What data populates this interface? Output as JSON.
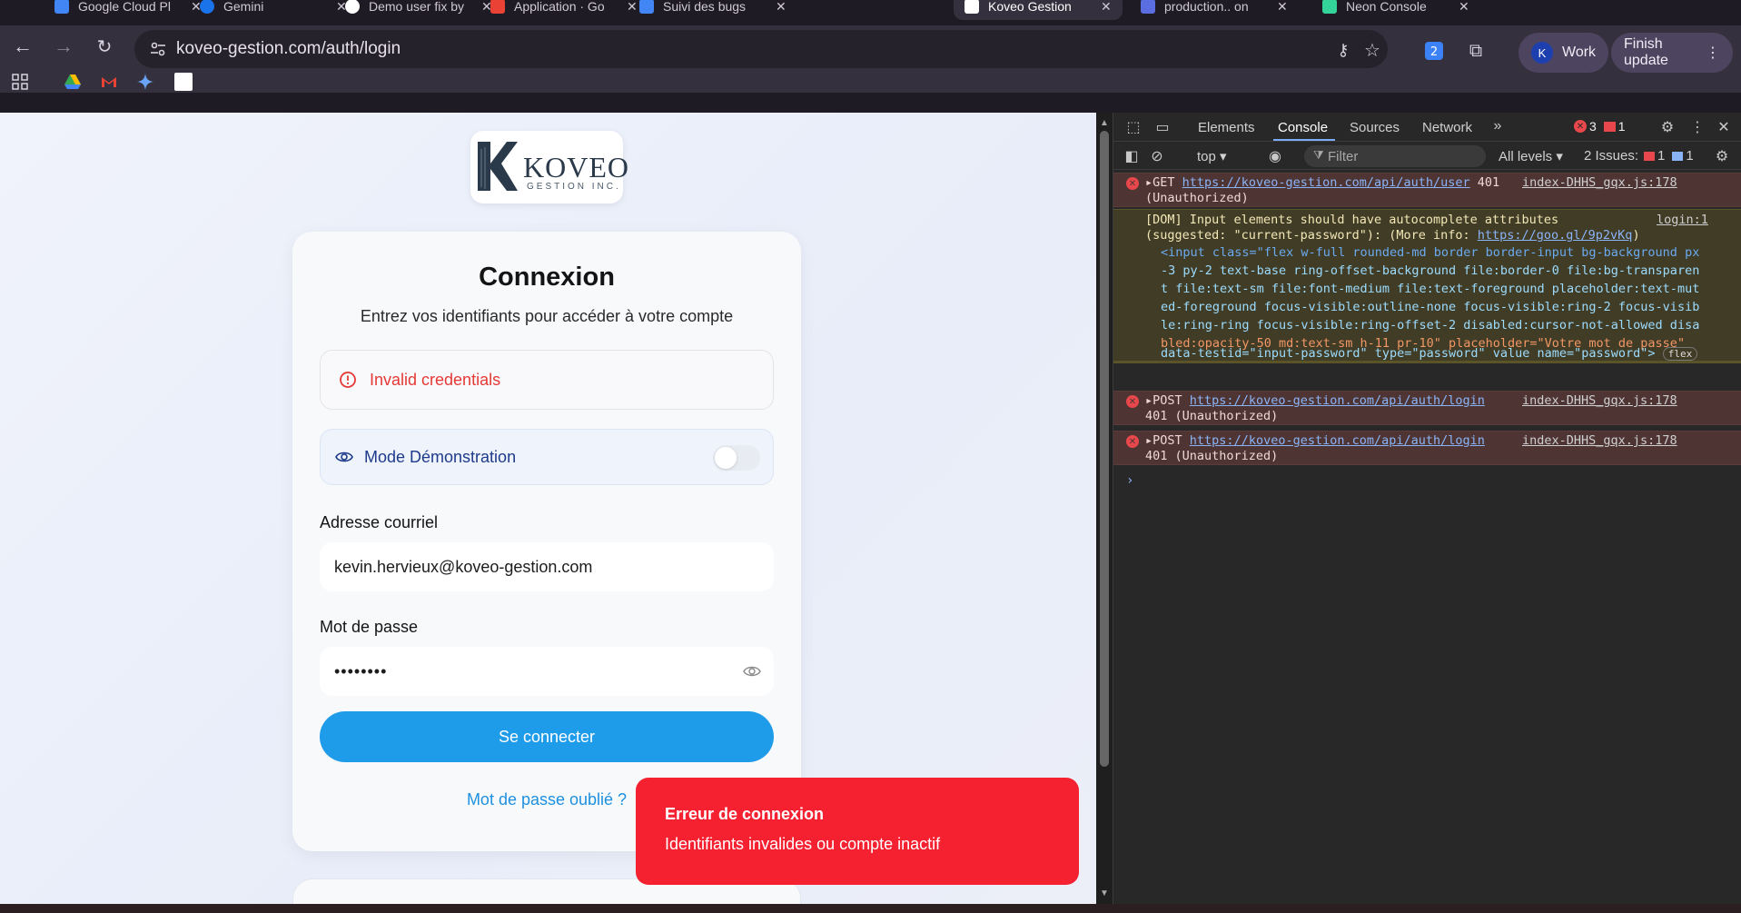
{
  "browser": {
    "tabs": [
      {
        "title": "Google Cloud Pl",
        "fav_color": "#4285f4"
      },
      {
        "title": "Gemini",
        "fav_color": "#1a73e8"
      },
      {
        "title": "Demo user fix by",
        "fav_color": "#ffffff"
      },
      {
        "title": "Application · Go",
        "fav_color": "#ea4335"
      },
      {
        "title": "Suivi des bugs",
        "fav_color": "#4285f4"
      },
      {
        "title": "Koveo Gestion",
        "fav_color": "#ffffff"
      },
      {
        "title": "production.. on",
        "fav_color": "#5b6ee1"
      },
      {
        "title": "Neon Console",
        "fav_color": "#34d399"
      }
    ],
    "url": "koveo-gestion.com/auth/login",
    "profile_label": "Work",
    "profile_initial": "K",
    "update_label": "Finish update",
    "extension_badge": "2"
  },
  "page": {
    "logo_text": "KOVEO",
    "logo_sub": "GESTION INC.",
    "title": "Connexion",
    "subtitle": "Entrez vos identifiants pour accéder à votre compte",
    "alert_text": "Invalid credentials",
    "demo_label": "Mode Démonstration",
    "email_label": "Adresse courriel",
    "email_value": "kevin.hervieux@koveo-gestion.com",
    "password_label": "Mot de passe",
    "password_value": "••••••••",
    "submit_label": "Se connecter",
    "forgot_label": "Mot de passe oublié ?",
    "toast_title": "Erreur de connexion",
    "toast_message": "Identifiants invalides ou compte inactif"
  },
  "devtools": {
    "tabs": [
      "Elements",
      "Console",
      "Sources",
      "Network"
    ],
    "active_tab": "Console",
    "error_count": "3",
    "warn_count": "1",
    "context": "top",
    "filter_placeholder": "Filter",
    "levels": "All levels",
    "issues_label": "2 Issues:",
    "issues_err": "1",
    "issues_info": "1",
    "messages": {
      "m1_method": "GET",
      "m1_url": "https://koveo-gestion.com/api/auth/user",
      "m1_status": "401",
      "m1_status2": "(Unauthorized)",
      "m1_src": "index-DHHS_gqx.js:178",
      "w_line1": "[DOM] Input elements should have autocomplete attributes",
      "w_src": "login:1",
      "w_line2_pre": "(suggested: \"current-password\"): (More info: ",
      "w_line2_link": "https://goo.gl/9p2vKq",
      "w_line2_post": ")",
      "code1": "<input class=\"flex w-full rounded-md border border-input bg-background px",
      "code2": "-3 py-2 text-base ring-offset-background file:border-0 file:bg-transparen",
      "code3": "t file:text-sm file:font-medium file:text-foreground placeholder:text-mut",
      "code4": "ed-foreground focus-visible:outline-none focus-visible:ring-2 focus-visib",
      "code5": "le:ring-ring focus-visible:ring-offset-2 disabled:cursor-not-allowed disa",
      "code6": "bled:opacity-50 md:text-sm h-11 pr-10\" placeholder=\"Votre mot de passe\"",
      "code7": "data-testid=\"input-password\" type=\"password\" value name=\"password\">",
      "flex_badge": "flex",
      "m3_method": "POST",
      "m3_url": "https://koveo-gestion.com/api/auth/login",
      "m3_status": "401 (Unauthorized)",
      "m3_src": "index-DHHS_gqx.js:178",
      "m4_method": "POST",
      "m4_url": "https://koveo-gestion.com/api/auth/login",
      "m4_status": "401 (Unauthorized)",
      "m4_src": "index-DHHS_gqx.js:178"
    }
  }
}
